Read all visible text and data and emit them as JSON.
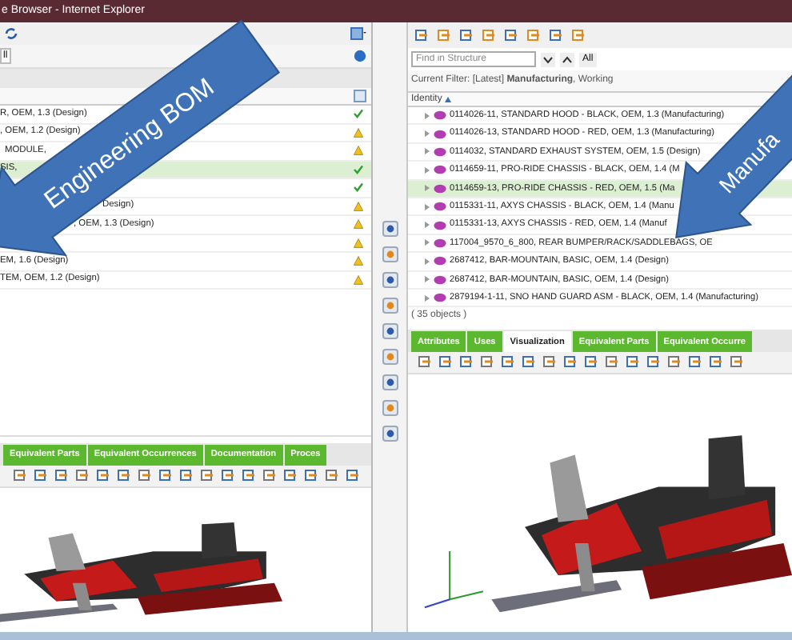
{
  "window": {
    "title": "e Browser - Internet Explorer"
  },
  "left_pane": {
    "button": "ll",
    "rows": [
      {
        "text": "R, OEM, 1.3 (Design)",
        "approved": true,
        "selected": false
      },
      {
        "text": ", OEM, 1.2 (Design)",
        "approved": false,
        "selected": false
      },
      {
        "text": "MODULE,",
        "approved": false,
        "selected": false
      },
      {
        "text": "SIS,",
        "approved": true,
        "selected": true
      },
      {
        "approved": true,
        "selected": false
      },
      {
        "text": "Design)",
        "approved": false,
        "selected": false
      },
      {
        "text": ", OEM, 1.3 (Design)",
        "approved": false,
        "selected": false
      },
      {
        "approved": false,
        "selected": false
      },
      {
        "text": "EM, 1.6 (Design)",
        "approved": false,
        "selected": false
      },
      {
        "text": "TEM, OEM, 1.2 (Design)",
        "approved": false,
        "selected": false
      }
    ],
    "tabs": [
      {
        "label": "Equivalent Parts",
        "selected": false
      },
      {
        "label": "Equivalent Occurrences",
        "selected": false
      },
      {
        "label": "Documentation",
        "selected": false
      },
      {
        "label": "Proces",
        "selected": false
      }
    ]
  },
  "right_pane": {
    "search": {
      "placeholder": "Find in Structure"
    },
    "all_button": "All",
    "filter": "Current Filter: [Latest] **Manufacturing**, Working",
    "column": "Identity",
    "rows": [
      {
        "text": "0114026-11, STANDARD HOOD - BLACK, OEM, 1.3 (Manufacturing)",
        "selected": false
      },
      {
        "text": "0114026-13, STANDARD HOOD - RED, OEM, 1.3 (Manufacturing)",
        "selected": false
      },
      {
        "text": "0114032, STANDARD EXHAUST SYSTEM, OEM, 1.5 (Design)",
        "selected": false
      },
      {
        "text": "0114659-11, PRO-RIDE CHASSIS - BLACK, OEM, 1.4 (M",
        "selected": false
      },
      {
        "text": "0114659-13, PRO-RIDE CHASSIS - RED, OEM, 1.5 (Ma",
        "selected": true
      },
      {
        "text": "0115331-11, AXYS CHASSIS - BLACK, OEM, 1.4 (Manu",
        "selected": false
      },
      {
        "text": "0115331-13, AXYS CHASSIS - RED, OEM, 1.4 (Manuf",
        "selected": false
      },
      {
        "text": "117004_9570_6_800, REAR BUMPER/RACK/SADDLEBAGS, OE",
        "selected": false
      },
      {
        "text": "2687412, BAR-MOUNTAIN, BASIC, OEM, 1.4 (Design)",
        "selected": false
      },
      {
        "text": "2687412, BAR-MOUNTAIN, BASIC, OEM, 1.4 (Design)",
        "selected": false
      },
      {
        "text": "2879194-1-11, SNO HAND GUARD ASM - BLACK, OEM, 1.4 (Manufacturing)",
        "selected": false
      }
    ],
    "count": "( 35 objects )",
    "tabs": [
      {
        "label": "Attributes",
        "selected": false
      },
      {
        "label": "Uses",
        "selected": false
      },
      {
        "label": "Visualization",
        "selected": true
      },
      {
        "label": "Equivalent Parts",
        "selected": false
      },
      {
        "label": "Equivalent Occurre",
        "selected": false
      }
    ]
  },
  "annotations": [
    {
      "text": "Engineering BOM"
    },
    {
      "text": "Manufa"
    }
  ]
}
